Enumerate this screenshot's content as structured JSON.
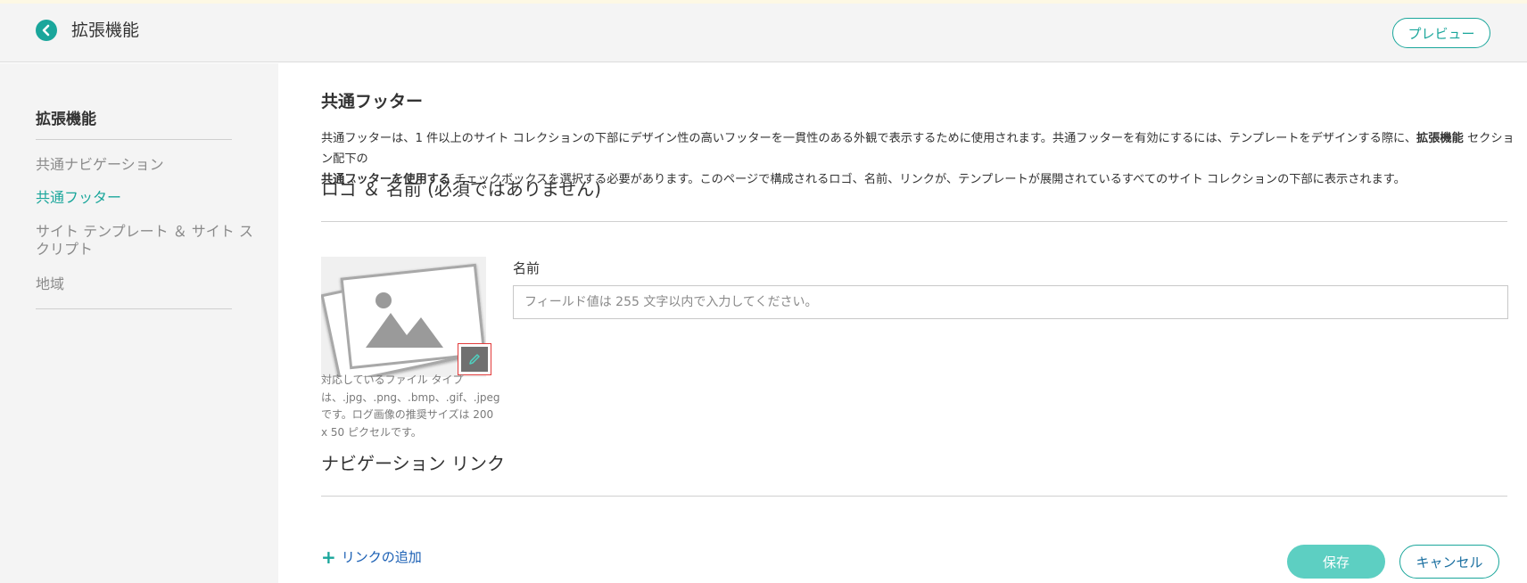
{
  "header": {
    "title": "拡張機能",
    "preview_label": "プレビュー"
  },
  "sidebar": {
    "title": "拡張機能",
    "items": [
      {
        "label": "共通ナビゲーション",
        "active": false
      },
      {
        "label": "共通フッター",
        "active": true
      },
      {
        "label": "サイト テンプレート ＆ サイト スクリプト",
        "active": false
      },
      {
        "label": "地域",
        "active": false
      }
    ]
  },
  "main": {
    "page_title": "共通フッター",
    "description": {
      "part1": "共通フッターは、1 件以上のサイト コレクションの下部にデザイン性の高いフッターを一貫性のある外観で表示するために使用されます。共通フッターを有効にするには、テンプレートをデザインする際に、",
      "bold1": "拡張機能",
      "part2": " セクション配下の",
      "bold2": "共通フッターを使用する",
      "part3": " チェックボックスを選択する必要があります。このページで構成されるロゴ、名前、リンクが、テンプレートが展開されているすべてのサイト コレクションの下部に表示されます。"
    },
    "logo_section_title": "ロゴ ＆ 名前 (必須ではありません)",
    "file_type_note": "対応しているファイル タイプは、.jpg、.png、.bmp、.gif、.jpegです。ログ画像の推奨サイズは 200 x 50 ピクセルです。",
    "name_label": "名前",
    "name_placeholder": "フィールド値は 255 文字以内で入力してください。",
    "name_value": "",
    "nav_section_title": "ナビゲーション リンク",
    "add_link_label": "リンクの追加",
    "save_label": "保存",
    "cancel_label": "キャンセル"
  },
  "colors": {
    "accent": "#1aa69b",
    "save_button": "#5dcfc2",
    "link": "#1a5fb4",
    "edit_highlight": "#e23b3b"
  },
  "icons": {
    "back": "chevron-left-icon",
    "logo_placeholder": "image-placeholder-icon",
    "edit": "pencil-icon",
    "add": "plus-icon"
  }
}
